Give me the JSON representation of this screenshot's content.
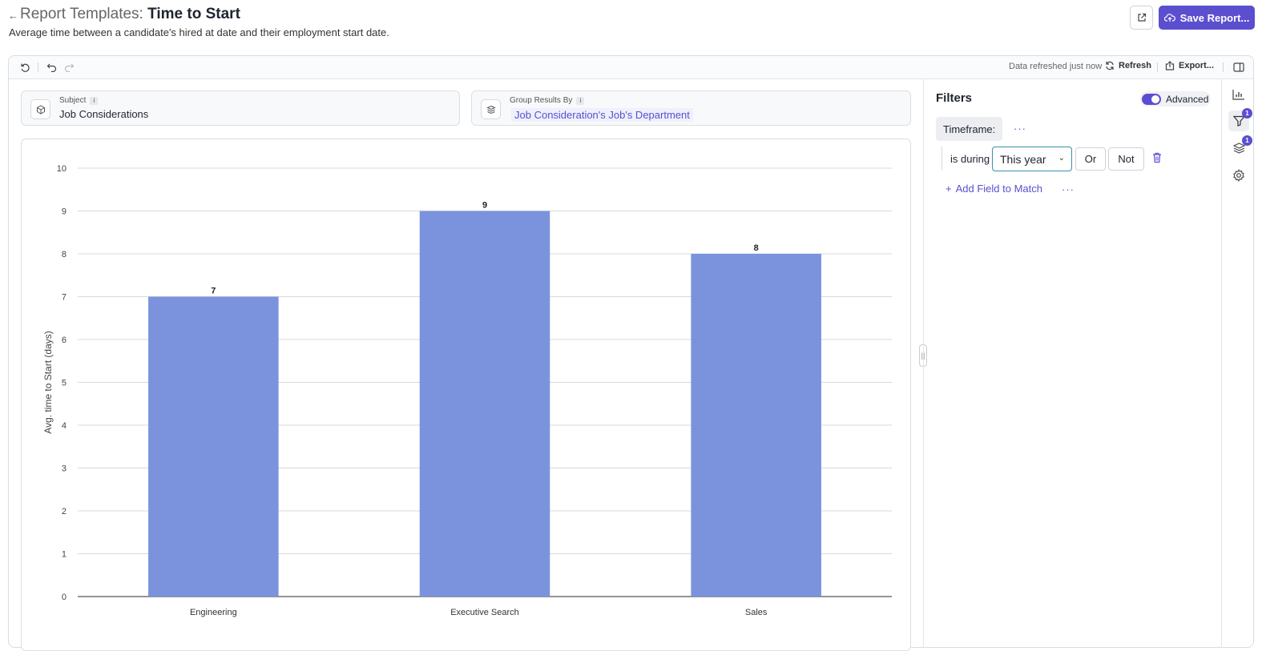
{
  "header": {
    "prefix": "Report Templates:",
    "title": "Time to Start",
    "subtitle": "Average time between a candidate's hired at date and their employment start date.",
    "save_label": "Save Report..."
  },
  "toolbar": {
    "refreshed_text": "Data refreshed just now",
    "refresh_label": "Refresh",
    "export_label": "Export..."
  },
  "subject": {
    "label": "Subject",
    "value": "Job Considerations",
    "info": "i"
  },
  "group_by": {
    "label": "Group Results By",
    "value": "Job Consideration's Job's Department",
    "info": "i"
  },
  "filters": {
    "title": "Filters",
    "advanced_label": "Advanced",
    "advanced_on": true,
    "field_label": "Timeframe:",
    "operator": "is during",
    "selected_value": "This year",
    "or_label": "Or",
    "not_label": "Not",
    "add_field_label": "Add Field to Match"
  },
  "rail": {
    "filter_badge": "1",
    "layers_badge": "1"
  },
  "colors": {
    "accent": "#5b4fcf",
    "bar": "#7b93dc"
  },
  "chart_data": {
    "type": "bar",
    "categories": [
      "Engineering",
      "Executive Search",
      "Sales"
    ],
    "values": [
      7,
      9,
      8
    ],
    "title": "",
    "xlabel": "",
    "ylabel": "Avg. time to Start (days)",
    "ylim": [
      0,
      10
    ],
    "yticks": [
      0,
      1,
      2,
      3,
      4,
      5,
      6,
      7,
      8,
      9,
      10
    ],
    "grid": true,
    "data_labels": true
  }
}
